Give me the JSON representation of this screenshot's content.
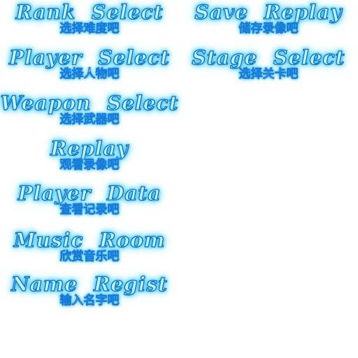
{
  "menu": {
    "items": [
      {
        "title": "Rank Select",
        "subtitle": "选择难度吧"
      },
      {
        "title": "Player Select",
        "subtitle": "选择人物吧"
      },
      {
        "title": "Weapon Select",
        "subtitle": "选择武器吧"
      },
      {
        "title": "Replay",
        "subtitle": "观看录像吧"
      },
      {
        "title": "Player Data",
        "subtitle": "查看记录吧"
      },
      {
        "title": "Music Room",
        "subtitle": "欣赏音乐吧"
      },
      {
        "title": "Name Regist",
        "subtitle": "输入名字吧"
      },
      {
        "title": "Save Replay",
        "subtitle": "储存录像吧"
      },
      {
        "title": "Stage Select",
        "subtitle": "选择关卡吧"
      }
    ]
  },
  "colors": {
    "background": "#ffffff",
    "glow": "#29d4ff",
    "outline": "#0a6fd0",
    "fill": "#c8f2ff"
  }
}
